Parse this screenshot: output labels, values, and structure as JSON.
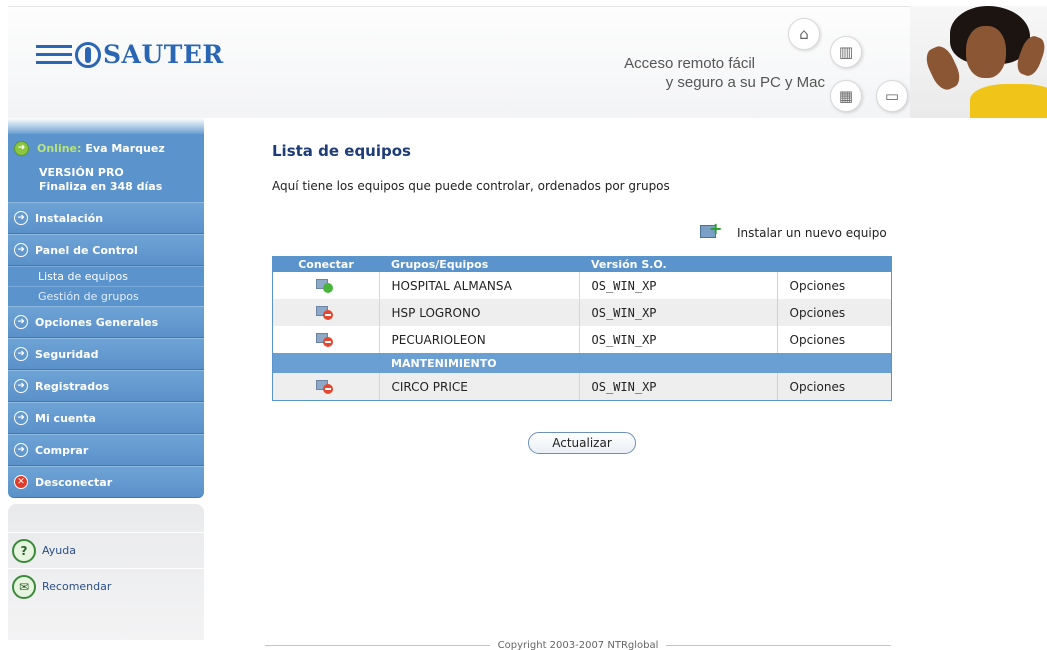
{
  "header": {
    "logo_text": "SAUTER",
    "tagline_line1": "Acceso remoto fácil",
    "tagline_line2": "y seguro a su PC y Mac"
  },
  "sidebar": {
    "user": {
      "online_label": "Online:",
      "name": "Eva Marquez",
      "version_line1": "VERSIÓN PRO",
      "version_line2": "Finaliza en 348 días"
    },
    "items": [
      {
        "label": "Instalación"
      },
      {
        "label": "Panel de Control"
      },
      {
        "label": "Opciones Generales"
      },
      {
        "label": "Seguridad"
      },
      {
        "label": "Registrados"
      },
      {
        "label": "Mi cuenta"
      },
      {
        "label": "Comprar"
      },
      {
        "label": "Desconectar"
      }
    ],
    "subitems": [
      {
        "label": "Lista de equipos"
      },
      {
        "label": "Gestión de grupos"
      }
    ],
    "help_items": [
      {
        "label": "Ayuda"
      },
      {
        "label": "Recomendar"
      }
    ]
  },
  "main": {
    "title": "Lista de equipos",
    "intro": "Aquí tiene los equipos que puede controlar, ordenados por grupos",
    "install_label": "Instalar un nuevo equipo",
    "table": {
      "headers": [
        "Conectar",
        "Grupos/Equipos",
        "Versión S.O.",
        ""
      ],
      "rows": [
        {
          "status": "online",
          "name": "HOSPITAL ALMANSA",
          "os": "OS_WIN_XP",
          "action": "Opciones"
        },
        {
          "status": "offline",
          "name": "HSP LOGRONO",
          "os": "OS_WIN_XP",
          "action": "Opciones"
        },
        {
          "status": "offline",
          "name": "PECUARIOLEON",
          "os": "OS_WIN_XP",
          "action": "Opciones"
        }
      ],
      "group_label": "MANTENIMIENTO",
      "group_rows": [
        {
          "status": "offline",
          "name": "CIRCO PRICE",
          "os": "OS_WIN_XP",
          "action": "Opciones"
        }
      ]
    },
    "refresh_label": "Actualizar"
  },
  "footer": {
    "copyright": "Copyright 2003-2007 NTRglobal"
  },
  "colors": {
    "accent": "#5b93cc",
    "title": "#1e3c78",
    "online": "#48b53a",
    "offline": "#e4472f"
  }
}
